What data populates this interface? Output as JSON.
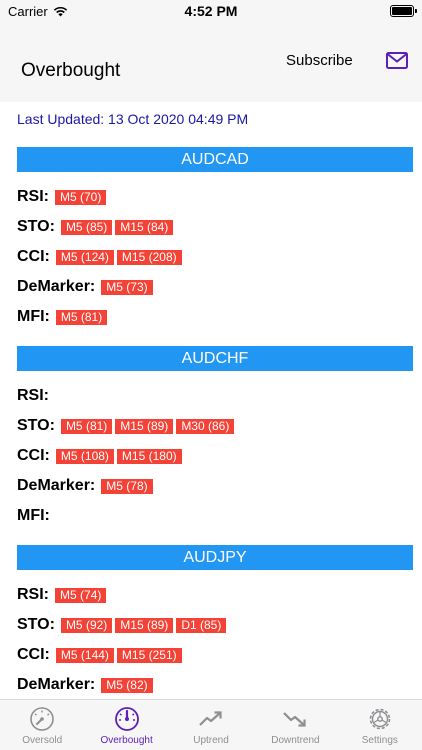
{
  "status": {
    "carrier": "Carrier",
    "time": "4:52 PM"
  },
  "nav": {
    "title": "Overbought",
    "subscribe": "Subscribe"
  },
  "last_updated": "Last Updated: 13 Oct 2020 04:49 PM",
  "colors": {
    "header_blue": "#2196f3",
    "tag_red": "#f44336",
    "active_purple": "#5c1fb8",
    "updated_text": "#1b17a8"
  },
  "sections": [
    {
      "pair": "AUDCAD",
      "rows": [
        {
          "label": "RSI:",
          "tags": [
            "M5 (70)"
          ]
        },
        {
          "label": "STO:",
          "tags": [
            "M5 (85)",
            "M15 (84)"
          ]
        },
        {
          "label": "CCI:",
          "tags": [
            "M5 (124)",
            "M15 (208)"
          ]
        },
        {
          "label": "DeMarker:",
          "tags": [
            "M5 (73)"
          ]
        },
        {
          "label": "MFI:",
          "tags": [
            "M5 (81)"
          ]
        }
      ]
    },
    {
      "pair": "AUDCHF",
      "rows": [
        {
          "label": "RSI:",
          "tags": []
        },
        {
          "label": "STO:",
          "tags": [
            "M5 (81)",
            "M15 (89)",
            "M30 (86)"
          ]
        },
        {
          "label": "CCI:",
          "tags": [
            "M5 (108)",
            "M15 (180)"
          ]
        },
        {
          "label": "DeMarker:",
          "tags": [
            "M5 (78)"
          ]
        },
        {
          "label": "MFI:",
          "tags": []
        }
      ]
    },
    {
      "pair": "AUDJPY",
      "rows": [
        {
          "label": "RSI:",
          "tags": [
            "M5 (74)"
          ]
        },
        {
          "label": "STO:",
          "tags": [
            "M5 (92)",
            "M15 (89)",
            "D1 (85)"
          ]
        },
        {
          "label": "CCI:",
          "tags": [
            "M5 (144)",
            "M15 (251)"
          ]
        },
        {
          "label": "DeMarker:",
          "tags": [
            "M5 (82)"
          ]
        }
      ]
    }
  ],
  "tabs": [
    {
      "label": "Oversold",
      "icon": "gauge-low-icon",
      "active": false
    },
    {
      "label": "Overbought",
      "icon": "gauge-high-icon",
      "active": true
    },
    {
      "label": "Uptrend",
      "icon": "trend-up-icon",
      "active": false
    },
    {
      "label": "Downtrend",
      "icon": "trend-down-icon",
      "active": false
    },
    {
      "label": "Settings",
      "icon": "gear-icon",
      "active": false
    }
  ]
}
